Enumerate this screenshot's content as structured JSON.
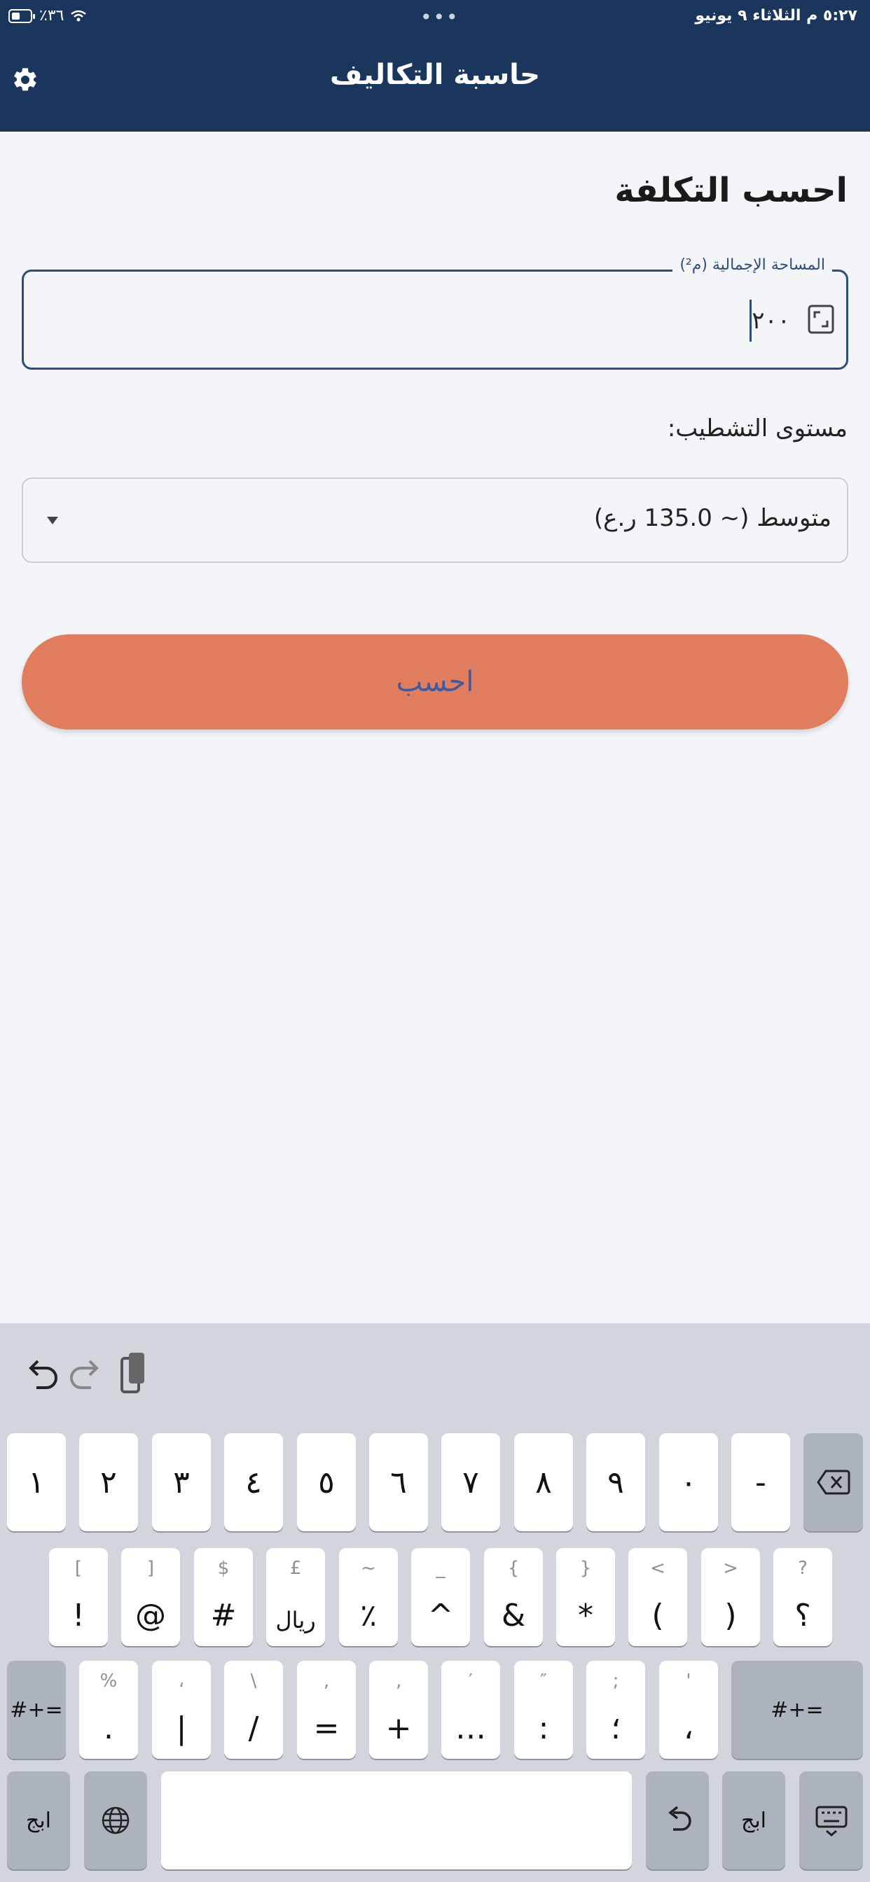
{
  "status_bar": {
    "time_date": "٥:٢٧ م   الثلاثاء ٩ يونيو",
    "battery": "٪٣٦"
  },
  "header": {
    "title": "حاسبة التكاليف"
  },
  "section_title": "احسب التكلفة",
  "area_field": {
    "label": "المساحة الإجمالية (م²)",
    "value": "٢٠٠"
  },
  "finish_level": {
    "label": "مستوى التشطيب:",
    "selected": "متوسط (~ 135.0 ر.ع)"
  },
  "calculate_button": "احسب",
  "keyboard": {
    "row1": [
      "١",
      "٢",
      "٣",
      "٤",
      "٥",
      "٦",
      "٧",
      "٨",
      "٩",
      "٠",
      "-"
    ],
    "row2": [
      {
        "main": "!",
        "sub": "["
      },
      {
        "main": "@",
        "sub": "]"
      },
      {
        "main": "#",
        "sub": "$"
      },
      {
        "main": "ريال",
        "sub": "£"
      },
      {
        "main": "٪",
        "sub": "~"
      },
      {
        "main": "^",
        "sub": "_"
      },
      {
        "main": "&",
        "sub": "{"
      },
      {
        "main": "*",
        "sub": "}"
      },
      {
        "main": "(",
        "sub": "<"
      },
      {
        "main": ")",
        "sub": ">"
      },
      {
        "main": "؟",
        "sub": "?"
      }
    ],
    "row3": [
      {
        "main": ".",
        "sub": "%"
      },
      {
        "main": "|",
        "sub": "،"
      },
      {
        "main": "/",
        "sub": "\\"
      },
      {
        "main": "=",
        "sub": ","
      },
      {
        "main": "+",
        "sub": "‚"
      },
      {
        "main": "…",
        "sub": "′"
      },
      {
        "main": ":",
        "sub": "″"
      },
      {
        "main": "؛",
        "sub": ";"
      },
      {
        "main": "،",
        "sub": "'"
      }
    ],
    "symbols_label": "#+=",
    "abc_label": "ابج"
  }
}
